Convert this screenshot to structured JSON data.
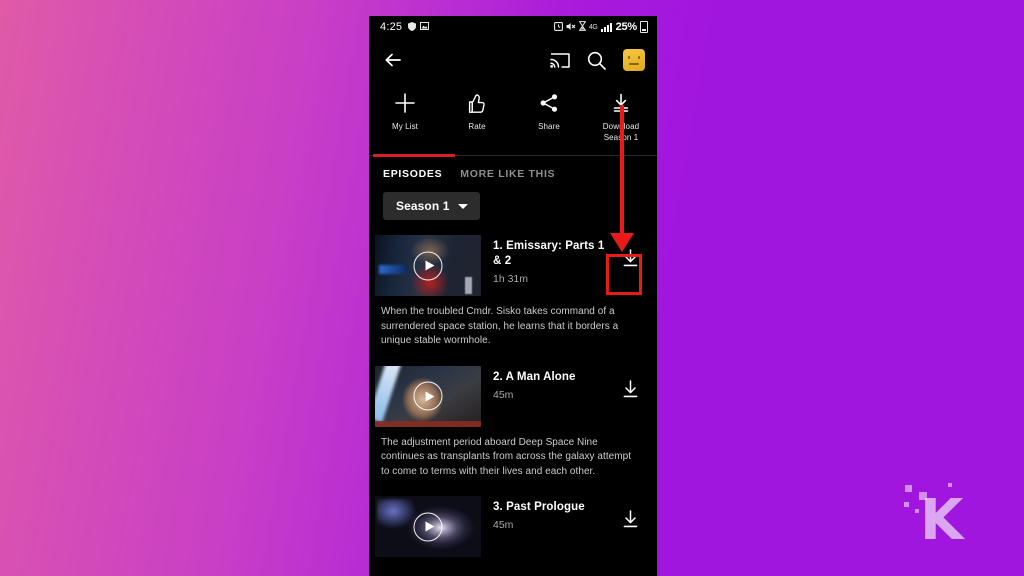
{
  "device": {
    "status_bar": {
      "time": "4:25",
      "left_icons": [
        "shield-icon",
        "image-icon"
      ],
      "right_icons": [
        "alarm-icon",
        "mute-icon",
        "hourglass-icon"
      ],
      "network_type": "4G",
      "signal": "signal-bars-icon",
      "battery_percent": "25%"
    },
    "nav_bar": {
      "back": "back-arrow-icon",
      "cast": "cast-icon",
      "search": "search-icon",
      "profile": "profile-avatar"
    }
  },
  "actions": [
    {
      "icon": "plus-icon",
      "label": "My List"
    },
    {
      "icon": "thumbs-up-icon",
      "label": "Rate"
    },
    {
      "icon": "share-icon",
      "label": "Share"
    },
    {
      "icon": "download-icon",
      "label": "Download\nSeason 1",
      "label_line1": "Download",
      "label_line2": "Season 1"
    }
  ],
  "tabs": [
    {
      "label": "EPISODES",
      "active": true
    },
    {
      "label": "MORE LIKE THIS",
      "active": false
    }
  ],
  "season_selector": {
    "label": "Season 1",
    "caret": "chevron-down-icon"
  },
  "episodes": [
    {
      "title": "1. Emissary: Parts 1 & 2",
      "duration": "1h 31m",
      "description": "When the troubled Cmdr. Sisko takes command of a surrendered space station, he learns that it borders a unique stable wormhole.",
      "download": "download-icon",
      "highlighted": true
    },
    {
      "title": "2. A Man Alone",
      "duration": "45m",
      "description": "The adjustment period aboard Deep Space Nine continues as transplants from across the galaxy attempt to come to terms with their lives and each other.",
      "download": "download-icon",
      "highlighted": false
    },
    {
      "title": "3. Past Prologue",
      "duration": "45m",
      "description": "",
      "download": "download-icon",
      "highlighted": false
    }
  ],
  "annotation": {
    "color": "#e81b18",
    "shape": "arrow-pointing-down-to-download-button"
  },
  "watermark": {
    "letter": "K"
  },
  "colors": {
    "accent_red": "#d81f26",
    "annotation_red": "#e81b18",
    "background_start": "#e05aa8",
    "background_end": "#a116de",
    "app_background": "#000000",
    "avatar_gold": "#f5c842"
  }
}
